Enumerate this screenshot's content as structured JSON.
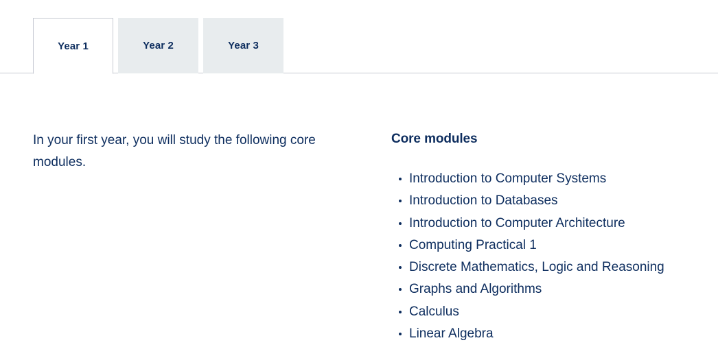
{
  "tabs": {
    "items": [
      {
        "label": "Year 1",
        "state": "active"
      },
      {
        "label": "Year 2",
        "state": "inactive"
      },
      {
        "label": "Year 3",
        "state": "inactive"
      }
    ]
  },
  "content": {
    "intro_paragraph": "In your first year, you will study the following core modules.",
    "modules_heading": "Core modules",
    "modules": [
      "Introduction to Computer Systems",
      "Introduction to Databases",
      "Introduction to Computer Architecture",
      "Computing Practical 1",
      "Discrete Mathematics, Logic and Reasoning",
      "Graphs and Algorithms",
      "Calculus",
      "Linear Algebra"
    ]
  },
  "colors": {
    "text_navy": "#0d2d5e",
    "tab_inactive_bg": "#e8ecee",
    "border_gray": "#c6c9d2",
    "page_bg": "#ffffff"
  }
}
